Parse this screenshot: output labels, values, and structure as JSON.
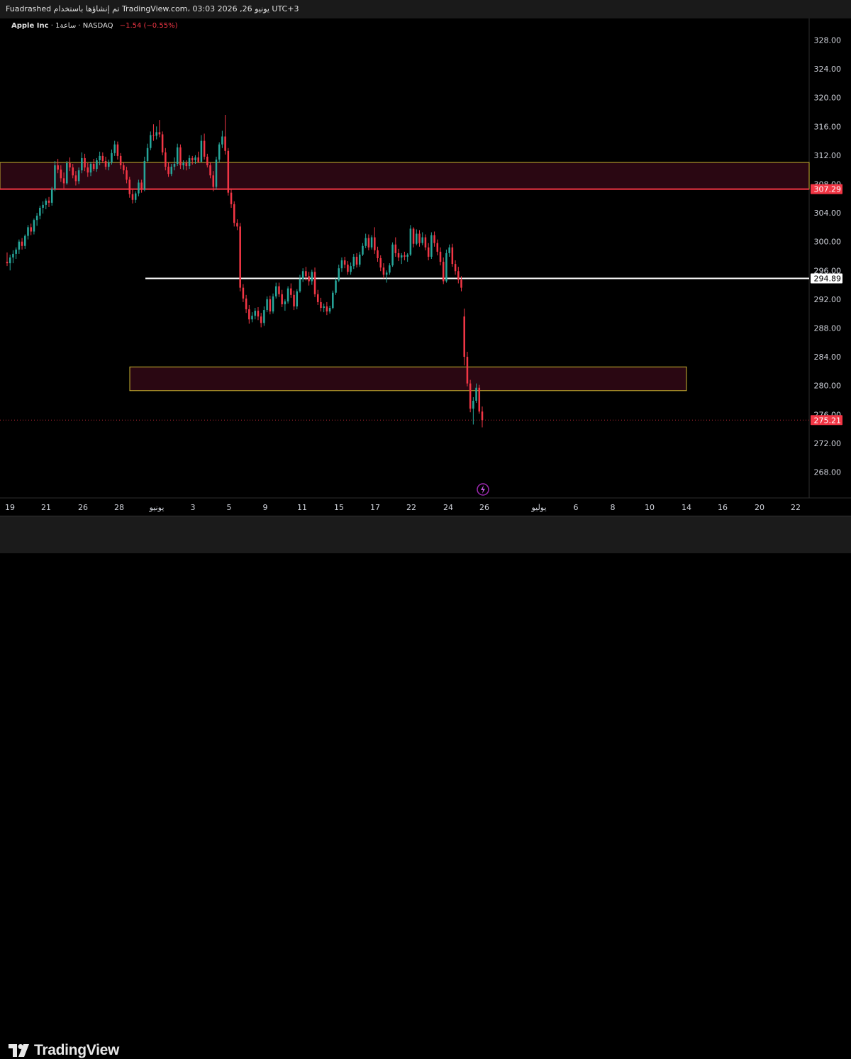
{
  "header": {
    "author": "Fuadrashed",
    "published_text": "تم إنشاؤها باستخدام TradingView.com، 03:03 2026 ,26 يونيو UTC+3"
  },
  "symbol": {
    "name": "Apple Inc",
    "interval": "1ساعة",
    "exchange": "NASDAQ",
    "sep": "·",
    "change": "−1.54 (−0.55%)"
  },
  "branding": {
    "logo_text": "TradingView",
    "logo_mark": "TV"
  },
  "colors": {
    "up": "#26a69a",
    "down": "#f23645",
    "zone_fill": "#2a0712",
    "zone_border": "#c9b330",
    "resistance_line": "#f23645",
    "support_line": "#ffffff",
    "price_tag_bg": "#f23645",
    "text": "#d1d4dc"
  },
  "chart_data": {
    "type": "candlestick",
    "title": "",
    "ylim": [
      264.5,
      331.0
    ],
    "y_ticks": [
      "328.00",
      "324.00",
      "320.00",
      "316.00",
      "312.00",
      "308.00",
      "304.00",
      "300.00",
      "296.00",
      "292.00",
      "288.00",
      "284.00",
      "280.00",
      "276.00",
      "272.00",
      "268.00"
    ],
    "x_tick_labels": [
      "19",
      "21",
      "26",
      "28",
      "يونيو",
      "3",
      "5",
      "9",
      "11",
      "15",
      "17",
      "22",
      "24",
      "26",
      "يوليو",
      "6",
      "8",
      "10",
      "14",
      "16",
      "20",
      "22"
    ],
    "horizontal_lines": [
      {
        "name": "resistance",
        "price": 307.29,
        "label": "307.29"
      },
      {
        "name": "support",
        "price": 294.89,
        "label": "294.89"
      }
    ],
    "zones": [
      {
        "name": "upper-zone",
        "top": 311.0,
        "bottom": 307.29
      },
      {
        "name": "lower-zone",
        "top": 282.6,
        "bottom": 279.3
      }
    ],
    "last_price": {
      "price": 275.21,
      "label": "275.21"
    },
    "ohlc": [
      [
        297.2,
        298.5,
        296.6,
        297.0
      ],
      [
        297.0,
        298.2,
        296.0,
        297.8
      ],
      [
        297.8,
        298.8,
        297.0,
        298.3
      ],
      [
        298.3,
        299.2,
        297.6,
        298.9
      ],
      [
        298.9,
        300.3,
        298.3,
        300.0
      ],
      [
        300.0,
        300.5,
        298.9,
        299.4
      ],
      [
        299.4,
        301.0,
        299.0,
        300.8
      ],
      [
        300.8,
        302.3,
        300.3,
        302.0
      ],
      [
        302.0,
        302.5,
        300.9,
        301.4
      ],
      [
        301.4,
        303.2,
        301.0,
        303.0
      ],
      [
        303.0,
        304.0,
        302.2,
        303.6
      ],
      [
        303.6,
        305.0,
        303.1,
        304.7
      ],
      [
        304.7,
        305.6,
        303.9,
        305.1
      ],
      [
        305.1,
        306.0,
        304.5,
        305.7
      ],
      [
        305.7,
        306.2,
        304.8,
        305.4
      ],
      [
        305.4,
        307.6,
        305.0,
        307.3
      ],
      [
        307.3,
        311.2,
        307.0,
        310.6
      ],
      [
        310.6,
        311.5,
        309.5,
        310.0
      ],
      [
        310.0,
        310.6,
        308.3,
        308.8
      ],
      [
        308.8,
        309.6,
        307.4,
        308.1
      ],
      [
        308.1,
        311.2,
        307.9,
        310.9
      ],
      [
        310.9,
        311.7,
        309.8,
        310.3
      ],
      [
        310.3,
        310.8,
        308.8,
        309.2
      ],
      [
        309.2,
        309.8,
        307.8,
        308.4
      ],
      [
        308.4,
        310.3,
        308.0,
        309.9
      ],
      [
        309.9,
        312.4,
        309.5,
        311.6
      ],
      [
        311.6,
        312.2,
        309.8,
        310.3
      ],
      [
        310.3,
        310.9,
        309.0,
        309.6
      ],
      [
        309.6,
        311.1,
        309.1,
        310.8
      ],
      [
        310.8,
        311.5,
        309.8,
        310.1
      ],
      [
        310.1,
        311.6,
        309.7,
        311.3
      ],
      [
        311.3,
        312.5,
        310.6,
        311.9
      ],
      [
        311.9,
        312.4,
        310.9,
        311.2
      ],
      [
        311.2,
        311.8,
        310.0,
        310.4
      ],
      [
        310.4,
        311.4,
        309.9,
        311.0
      ],
      [
        311.0,
        312.8,
        310.7,
        312.3
      ],
      [
        312.3,
        314.0,
        311.9,
        313.5
      ],
      [
        313.5,
        313.9,
        311.4,
        311.9
      ],
      [
        311.9,
        312.3,
        310.1,
        310.6
      ],
      [
        310.6,
        311.0,
        309.4,
        309.9
      ],
      [
        309.9,
        310.4,
        308.1,
        308.6
      ],
      [
        308.6,
        309.0,
        306.1,
        306.6
      ],
      [
        306.6,
        307.2,
        305.3,
        305.8
      ],
      [
        305.8,
        307.0,
        305.4,
        306.7
      ],
      [
        306.7,
        308.6,
        306.3,
        308.2
      ],
      [
        308.2,
        308.6,
        306.8,
        307.2
      ],
      [
        307.2,
        311.8,
        307.0,
        311.2
      ],
      [
        311.2,
        313.6,
        311.0,
        313.0
      ],
      [
        313.0,
        315.3,
        312.7,
        314.8
      ],
      [
        314.8,
        316.3,
        314.0,
        314.7
      ],
      [
        314.7,
        316.0,
        314.2,
        315.2
      ],
      [
        315.2,
        316.9,
        314.5,
        314.9
      ],
      [
        314.9,
        315.3,
        312.0,
        312.4
      ],
      [
        312.4,
        313.0,
        309.9,
        310.4
      ],
      [
        310.4,
        311.0,
        309.0,
        309.4
      ],
      [
        309.4,
        310.8,
        309.1,
        310.4
      ],
      [
        310.4,
        311.7,
        309.9,
        310.8
      ],
      [
        310.8,
        313.6,
        310.5,
        313.1
      ],
      [
        313.1,
        313.5,
        310.1,
        310.6
      ],
      [
        310.6,
        311.3,
        310.0,
        310.9
      ],
      [
        310.9,
        311.3,
        309.9,
        310.5
      ],
      [
        310.5,
        312.0,
        310.1,
        311.6
      ],
      [
        311.6,
        311.9,
        310.7,
        311.3
      ],
      [
        311.3,
        312.0,
        310.8,
        311.7
      ],
      [
        311.7,
        312.5,
        310.9,
        311.1
      ],
      [
        311.1,
        314.8,
        311.0,
        314.0
      ],
      [
        314.0,
        315.0,
        311.4,
        311.8
      ],
      [
        311.8,
        312.2,
        310.3,
        310.6
      ],
      [
        310.6,
        311.0,
        308.8,
        309.2
      ],
      [
        309.2,
        309.8,
        307.0,
        307.6
      ],
      [
        307.6,
        311.8,
        307.2,
        311.4
      ],
      [
        311.4,
        313.8,
        311.0,
        313.5
      ],
      [
        313.5,
        315.4,
        313.0,
        314.6
      ],
      [
        314.6,
        317.6,
        312.1,
        312.6
      ],
      [
        312.6,
        313.0,
        306.4,
        306.8
      ],
      [
        306.8,
        307.3,
        304.7,
        305.2
      ],
      [
        305.2,
        305.6,
        302.1,
        302.6
      ],
      [
        302.6,
        303.1,
        301.6,
        302.1
      ],
      [
        302.1,
        302.6,
        293.1,
        293.6
      ],
      [
        293.6,
        294.1,
        291.6,
        292.1
      ],
      [
        292.1,
        292.6,
        290.1,
        290.6
      ],
      [
        290.6,
        291.2,
        288.6,
        289.2
      ],
      [
        289.2,
        290.2,
        288.8,
        289.7
      ],
      [
        289.7,
        290.8,
        289.2,
        290.4
      ],
      [
        290.4,
        290.9,
        289.1,
        289.6
      ],
      [
        289.6,
        290.1,
        288.1,
        288.7
      ],
      [
        288.7,
        291.0,
        288.3,
        290.5
      ],
      [
        290.5,
        292.4,
        290.2,
        292.0
      ],
      [
        292.0,
        292.5,
        289.9,
        290.3
      ],
      [
        290.3,
        292.8,
        290.0,
        292.4
      ],
      [
        292.4,
        294.3,
        292.1,
        293.8
      ],
      [
        293.8,
        294.3,
        292.3,
        292.7
      ],
      [
        292.7,
        293.3,
        290.9,
        291.3
      ],
      [
        291.3,
        292.0,
        290.4,
        291.7
      ],
      [
        291.7,
        293.8,
        291.4,
        293.5
      ],
      [
        293.5,
        294.2,
        292.2,
        292.6
      ],
      [
        292.6,
        293.2,
        290.5,
        291.0
      ],
      [
        291.0,
        293.4,
        290.6,
        293.1
      ],
      [
        293.1,
        295.4,
        292.9,
        294.8
      ],
      [
        294.8,
        296.3,
        294.4,
        295.9
      ],
      [
        295.9,
        296.5,
        294.6,
        295.2
      ],
      [
        295.2,
        295.8,
        293.9,
        294.5
      ],
      [
        294.5,
        296.1,
        294.0,
        295.8
      ],
      [
        295.8,
        296.4,
        292.3,
        292.7
      ],
      [
        292.7,
        293.3,
        291.2,
        291.6
      ],
      [
        291.6,
        292.2,
        290.3,
        290.8
      ],
      [
        290.8,
        291.4,
        290.2,
        291.0
      ],
      [
        291.0,
        291.6,
        289.8,
        290.3
      ],
      [
        290.3,
        291.1,
        290.0,
        290.8
      ],
      [
        290.8,
        293.2,
        290.6,
        292.9
      ],
      [
        292.9,
        294.9,
        292.6,
        294.6
      ],
      [
        294.6,
        296.8,
        294.4,
        296.3
      ],
      [
        296.3,
        297.8,
        295.8,
        297.4
      ],
      [
        297.4,
        297.9,
        296.3,
        296.8
      ],
      [
        296.8,
        297.3,
        295.4,
        295.8
      ],
      [
        295.8,
        297.1,
        295.4,
        296.6
      ],
      [
        296.6,
        298.3,
        296.2,
        297.9
      ],
      [
        297.9,
        298.4,
        296.4,
        296.8
      ],
      [
        296.8,
        298.6,
        296.5,
        298.2
      ],
      [
        298.2,
        299.8,
        298.0,
        299.4
      ],
      [
        299.4,
        301.1,
        299.1,
        300.5
      ],
      [
        300.5,
        301.0,
        298.8,
        299.2
      ],
      [
        299.2,
        300.9,
        298.9,
        300.6
      ],
      [
        300.6,
        302.0,
        298.3,
        298.8
      ],
      [
        298.8,
        299.3,
        297.2,
        297.7
      ],
      [
        297.7,
        298.1,
        295.9,
        296.4
      ],
      [
        296.4,
        297.0,
        294.9,
        295.4
      ],
      [
        295.4,
        296.0,
        294.3,
        295.7
      ],
      [
        295.7,
        297.0,
        295.4,
        296.7
      ],
      [
        296.7,
        299.9,
        296.5,
        299.6
      ],
      [
        299.6,
        300.6,
        297.9,
        298.4
      ],
      [
        298.4,
        299.0,
        297.3,
        297.8
      ],
      [
        297.8,
        298.4,
        296.9,
        298.1
      ],
      [
        298.1,
        298.6,
        297.4,
        297.9
      ],
      [
        297.9,
        298.4,
        297.2,
        298.2
      ],
      [
        298.2,
        302.3,
        298.0,
        301.8
      ],
      [
        301.8,
        302.0,
        299.2,
        299.7
      ],
      [
        299.7,
        301.7,
        299.5,
        301.1
      ],
      [
        301.1,
        301.6,
        299.3,
        299.8
      ],
      [
        299.8,
        301.3,
        299.5,
        300.6
      ],
      [
        300.6,
        301.0,
        298.8,
        299.2
      ],
      [
        299.2,
        299.8,
        297.4,
        297.9
      ],
      [
        297.9,
        301.3,
        297.6,
        300.9
      ],
      [
        300.9,
        301.4,
        299.3,
        299.8
      ],
      [
        299.8,
        300.3,
        298.1,
        298.6
      ],
      [
        298.6,
        299.2,
        296.7,
        297.2
      ],
      [
        297.2,
        297.8,
        294.1,
        294.5
      ],
      [
        294.5,
        298.9,
        294.3,
        298.4
      ],
      [
        298.4,
        299.6,
        297.9,
        299.2
      ],
      [
        299.2,
        299.7,
        296.5,
        296.9
      ],
      [
        296.9,
        297.4,
        295.4,
        295.9
      ],
      [
        295.9,
        296.5,
        294.2,
        294.7
      ],
      [
        294.7,
        295.2,
        293.1,
        293.6
      ],
      [
        289.6,
        290.7,
        282.8,
        284.0
      ],
      [
        284.0,
        284.7,
        279.9,
        280.3
      ],
      [
        280.3,
        280.8,
        276.3,
        276.8
      ],
      [
        276.8,
        278.4,
        274.6,
        277.9
      ],
      [
        277.9,
        280.3,
        277.6,
        279.7
      ],
      [
        279.7,
        280.1,
        276.1,
        276.4
      ],
      [
        276.4,
        277.1,
        274.2,
        275.21
      ]
    ]
  }
}
